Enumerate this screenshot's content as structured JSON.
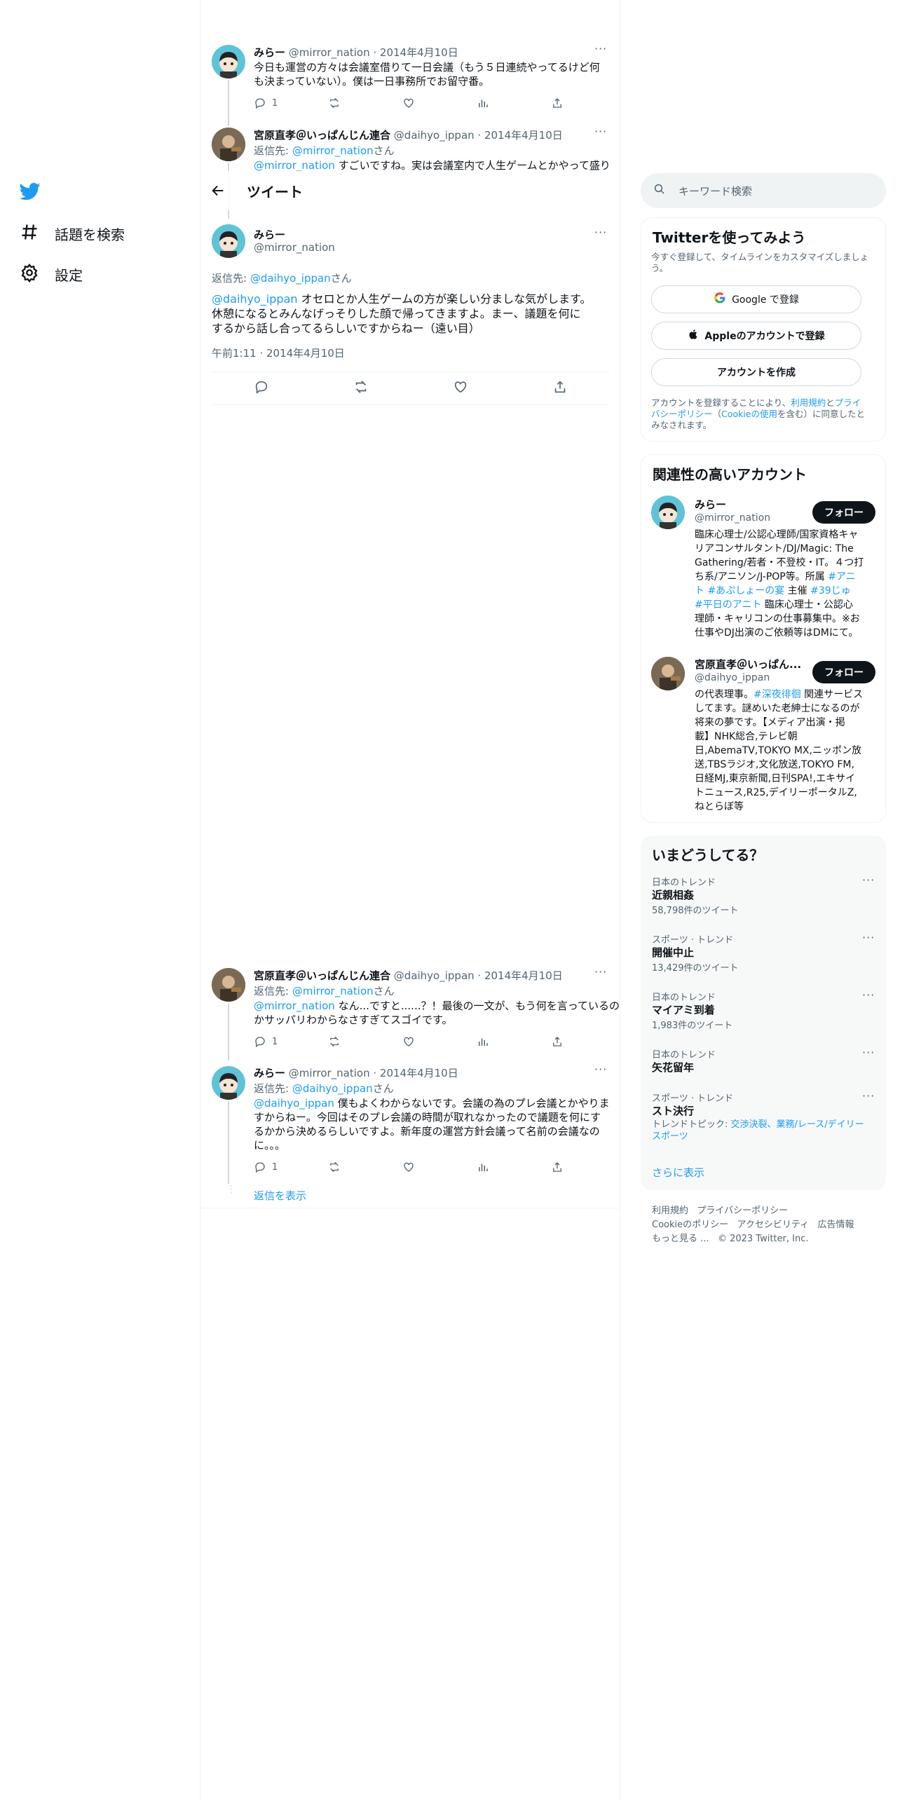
{
  "nav": {
    "items": [
      {
        "label": "話題を検索"
      },
      {
        "label": "設定"
      }
    ]
  },
  "header": {
    "title": "ツイート"
  },
  "tweets": {
    "t1": {
      "name": "みらー",
      "handle": "@mirror_nation",
      "date": "2014年4月10日",
      "text": "今日も運営の方々は会議室借りて一日会議（もう５日連続やってるけど何も決まっていない）。僕は一日事務所でお留守番。",
      "reply_count": "1"
    },
    "t2": {
      "name": "宮原直孝＠いっぱんじん連合",
      "handle": "@daihyo_ippan",
      "date": "2014年4月10日",
      "reply_to_label": "返信先: ",
      "reply_to": "@mirror_nation",
      "reply_to_suffix": "さん",
      "mention": "@mirror_nation",
      "text": " すごいですね。実は会議室内で人生ゲームとかやって盛り"
    },
    "main": {
      "name": "みらー",
      "handle": "@mirror_nation",
      "reply_to_label": "返信先: ",
      "reply_to": "@daihyo_ippan",
      "reply_to_suffix": "さん",
      "mention": "@daihyo_ippan",
      "text_l1": " オセロとか人生ゲームの方が楽しい分ましな気がします。",
      "text_l2": "休憩になるとみんなげっそりした顔で帰ってきますよ。まー、議題を何に",
      "text_l3": "するから話し合ってるらしいですからねー（遠い目）",
      "timestamp": "午前1:11 · 2014年4月10日"
    },
    "t3": {
      "name": "宮原直孝＠いっぱんじん連合",
      "handle": "@daihyo_ippan",
      "date": "2014年4月10日",
      "reply_to_label": "返信先: ",
      "reply_to": "@mirror_nation",
      "reply_to_suffix": "さん",
      "mention": "@mirror_nation",
      "text_l1": " なん...ですと......？！最後の一文が、もう何を言っているの",
      "text_l2": "かサッパリわからなさすぎてスゴイです。",
      "reply_count": "1"
    },
    "t4": {
      "name": "みらー",
      "handle": "@mirror_nation",
      "date": "2014年4月10日",
      "reply_to_label": "返信先: ",
      "reply_to": "@daihyo_ippan",
      "reply_to_suffix": "さん",
      "mention": "@daihyo_ippan",
      "text_l1": " 僕もよくわからないです。会議の為のプレ会議とかやりま",
      "text_l2": "すからねー。今回はそのプレ会議の時間が取れなかったので議題を何にす",
      "text_l3": "るかから決めるらしいですよ。新年度の運営方針会議って名前の会議なの",
      "text_l4": "に。。。",
      "reply_count": "1"
    },
    "show_replies": "返信を表示"
  },
  "search": {
    "placeholder": "キーワード検索"
  },
  "signup": {
    "title": "Twitterを使ってみよう",
    "subtitle_l1": "今すぐ登録して、タイムラインをカスタマイズしましょ",
    "subtitle_l2": "う。",
    "google": "Google で登録",
    "apple": "Appleのアカウントで登録",
    "create": "アカウントを作成",
    "terms_l1a": "アカウントを登録することにより、",
    "terms_l1b": "利用規約",
    "terms_l1c": "と",
    "terms_l1d": "プライ",
    "terms_l2a": "バシーポリシー",
    "terms_l2b": "（",
    "terms_l2c": "Cookieの使用",
    "terms_l2d": "を含む）に同意したと",
    "terms_l3": "みなされます。"
  },
  "related": {
    "title": "関連性の高いアカウント",
    "follow_label": "フォロー",
    "a1": {
      "name": "みらー",
      "handle": "@mirror_nation",
      "bio": [
        "臨床心理士/公認心理師/国家資格キャ",
        "リアコンサルタント/DJ/Magic: The",
        "Gathering/若者・不登校・IT。４つ打",
        "ち系/アニソン/J-POP等。所属 ",
        "#アニ",
        "ト #あぷしょーの宴",
        " 主催 ",
        "#39じゅ",
        "#平日のアニト",
        " 臨床心理士・公認心",
        "理師・キャリコンの仕事募集中。※お",
        "仕事やDJ出演のご依頼等はDMにて。"
      ]
    },
    "a2": {
      "name": "宮原直孝＠いっぱん...",
      "handle": "@daihyo_ippan",
      "bio": [
        "の代表理事。",
        "#深夜徘徊",
        " 関連サービス",
        "してます。謎めいた老紳士になるのが",
        "将来の夢です。【メディア出演・掲",
        "載】NHK総合,テレビ朝",
        "日,AbemaTV,TOKYO MX,ニッポン放",
        "送,TBSラジオ,文化放送,TOKYO FM,",
        "日経MJ,東京新聞,日刊SPA!,エキサイ",
        "トニュース,R25,デイリーポータルZ,",
        "ねとらぼ等"
      ]
    }
  },
  "trends": {
    "title": "いまどうしてる？",
    "items": [
      {
        "category": "日本のトレンド",
        "name": "近親相姦",
        "count": "58,798件のツイート"
      },
      {
        "category": "スポーツ · トレンド",
        "name": "開催中止",
        "count": "13,429件のツイート"
      },
      {
        "category": "日本のトレンド",
        "name": "マイアミ到着",
        "count": "1,983件のツイート"
      },
      {
        "category": "日本のトレンド",
        "name": "矢花留年",
        "count": ""
      },
      {
        "category": "スポーツ · トレンド",
        "name": "スト決行",
        "count": ""
      }
    ],
    "topic_label": "トレンドトピック: ",
    "topic_l1": "交渉決裂、業務/レース/デイリー",
    "topic_l2": "スポーツ",
    "show_more": "さらに表示"
  },
  "footer": {
    "terms": "利用規約",
    "privacy": "プライバシーポリシー",
    "cookie": "Cookieのポリシー",
    "access": "アクセシビリティ",
    "ads": "広告情報",
    "more": "もっと見る ...",
    "copyright": "© 2023 Twitter, Inc."
  },
  "colors": {
    "accent": "#1d9bf0",
    "text": "#0f1419",
    "muted": "#536471",
    "border": "#eff3f4"
  }
}
